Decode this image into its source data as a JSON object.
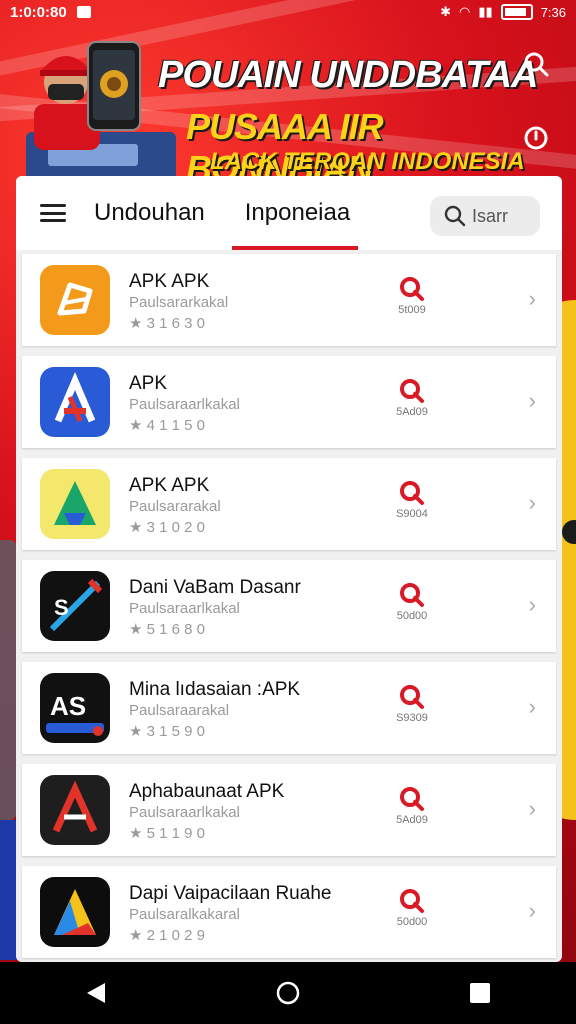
{
  "status_bar": {
    "time_left": "1:0:0:80",
    "time_right": "7:36"
  },
  "banner": {
    "line1": "POUAIN UNDDBATAA",
    "line2": "PUSAAA IIR BONNBIAN",
    "line3": "LACK TERQAN INDONESIA"
  },
  "header": {
    "tabs": [
      {
        "label": "Undouhan",
        "active": false
      },
      {
        "label": "Inponeiaa",
        "active": true
      }
    ],
    "search_label": "Isarr"
  },
  "apps": [
    {
      "name": "APK APK",
      "subtitle": "Paulsararkakal",
      "rating": "3 1 6 3 0",
      "size": "5t009",
      "icon": "apk-orange-icon"
    },
    {
      "name": "APK",
      "subtitle": "Paulsaraarlkakal",
      "rating": "4 1 1 5 0",
      "size": "5Ad09",
      "icon": "apk-blue-icon"
    },
    {
      "name": "APK APK",
      "subtitle": "Paulsararakal",
      "rating": "3 1 0 2 0",
      "size": "S9004",
      "icon": "apk-green-icon"
    },
    {
      "name": "Dani VaBam Dasanr",
      "subtitle": "Paulsaraarlkakal",
      "rating": "5 1 6 8 0",
      "size": "50d00",
      "icon": "apk-black-blue-icon"
    },
    {
      "name": "Mina lıdasaian :APK",
      "subtitle": "Paulsaraarakal",
      "rating": "3 1 5 9 0",
      "size": "S9309",
      "icon": "as-icon"
    },
    {
      "name": "Aphabaunaat APK",
      "subtitle": "Paulsaraarlkakal",
      "rating": "5 1 1 9 0",
      "size": "5Ad09",
      "icon": "apk-red-a-icon"
    },
    {
      "name": "Dapi Vaipacilaan Ruahe",
      "subtitle": "Paulsaralkakaral",
      "rating": "2 1 0 2 9",
      "size": "50d00",
      "icon": "apk-rainbow-a-icon"
    }
  ],
  "colors": {
    "accent": "#d81a26",
    "banner_red": "#c8101b",
    "banner_yellow": "#ffd21a"
  }
}
